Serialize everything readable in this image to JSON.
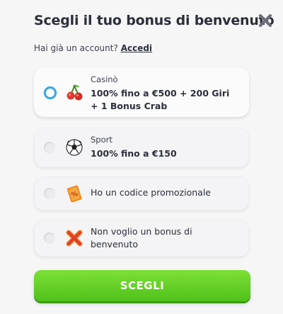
{
  "header": {
    "title": "Scegli il tuo bonus di benvenuto",
    "account_prompt": "Hai già un account?",
    "login_link": "Accedi"
  },
  "options": [
    {
      "category": "Casinò",
      "line1": "100% fino a €500 + 200 Giri",
      "line2": "+ 1 Bonus Crab",
      "icon": "cherry-icon",
      "selected": true
    },
    {
      "category": "Sport",
      "line1": "100% fino a €150",
      "icon": "soccer-ball-icon",
      "selected": false
    },
    {
      "line1": "Ho un codice promozionale",
      "icon": "promo-ticket-icon",
      "selected": false
    },
    {
      "line1": "Non voglio un bonus di",
      "line2": "benvenuto",
      "icon": "red-x-icon",
      "selected": false
    }
  ],
  "cta": {
    "label": "SCEGLI"
  },
  "colors": {
    "accent_green": "#5ccc22",
    "radio_selected": "#3aa7e6",
    "text_dark": "#2b2f3a"
  }
}
